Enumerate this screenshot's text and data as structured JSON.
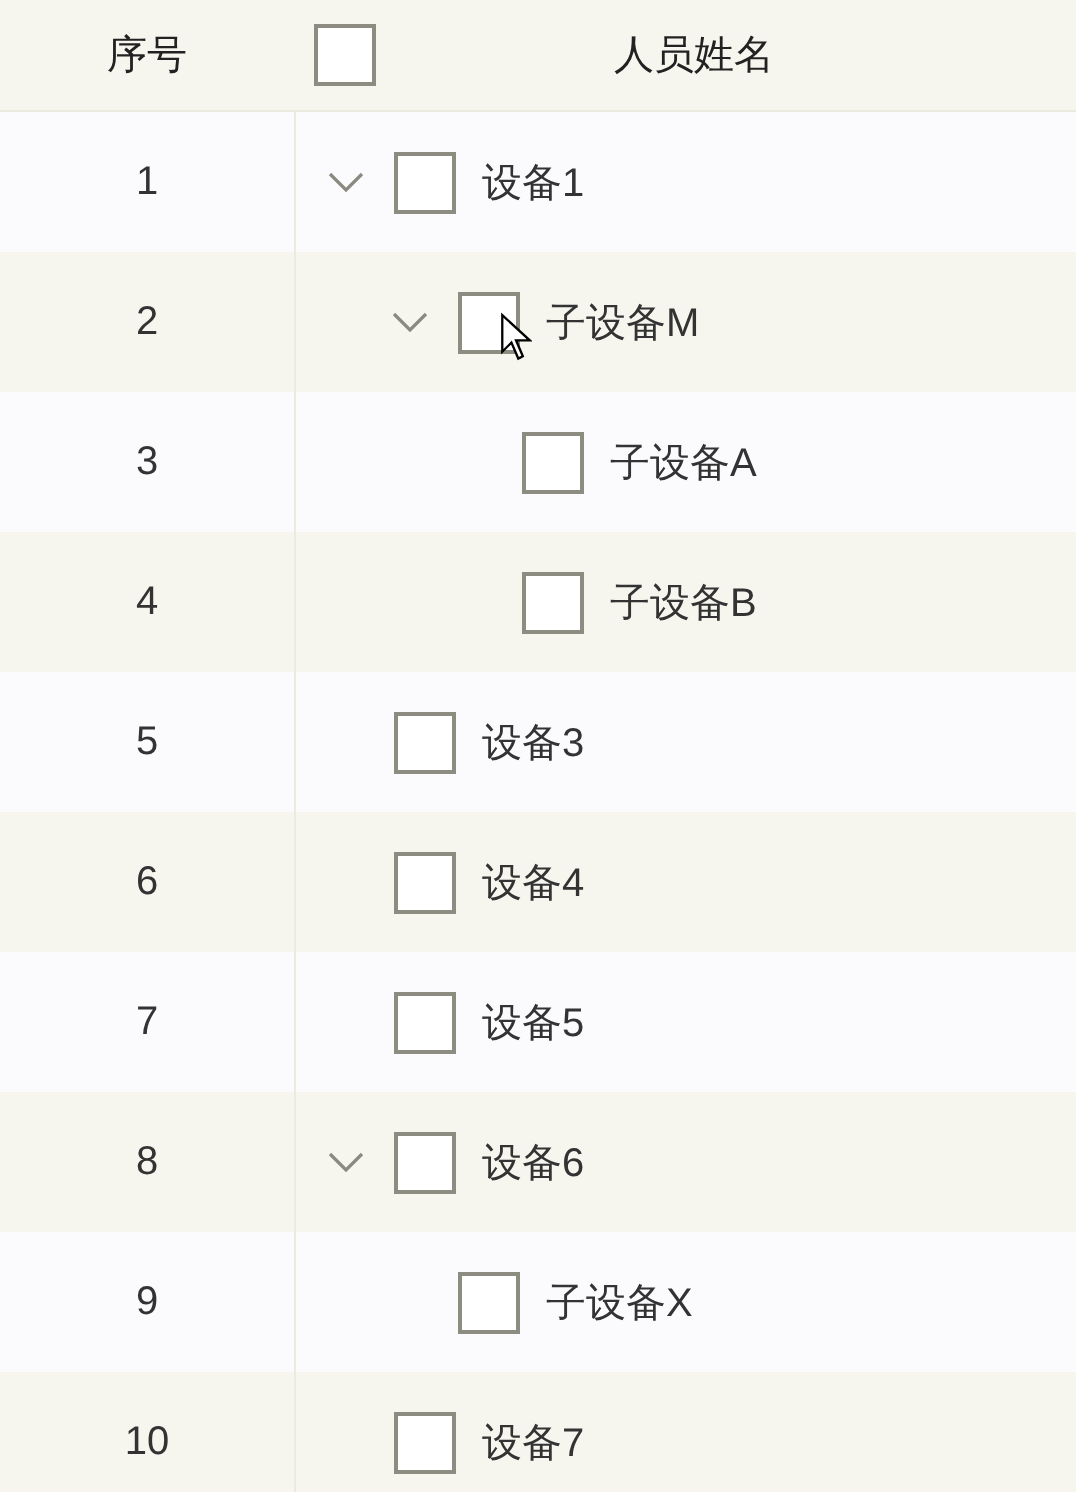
{
  "header": {
    "index_label": "序号",
    "checked": false,
    "name_label": "人员姓名"
  },
  "rows": [
    {
      "index": "1",
      "name": "设备1",
      "checked": false,
      "expanded": true,
      "children": [
        {
          "index": "2",
          "name": "子设备M",
          "checked": false,
          "expanded": true,
          "children": [
            {
              "index": "3",
              "name": "子设备A",
              "checked": false
            },
            {
              "index": "4",
              "name": "子设备B",
              "checked": false
            }
          ]
        }
      ]
    },
    {
      "index": "5",
      "name": "设备3",
      "checked": false
    },
    {
      "index": "6",
      "name": "设备4",
      "checked": false
    },
    {
      "index": "7",
      "name": "设备5",
      "checked": false
    },
    {
      "index": "8",
      "name": "设备6",
      "checked": false,
      "expanded": true,
      "children": [
        {
          "index": "9",
          "name": "子设备X",
          "checked": false
        }
      ]
    },
    {
      "index": "10",
      "name": "设备7",
      "checked": false
    }
  ]
}
